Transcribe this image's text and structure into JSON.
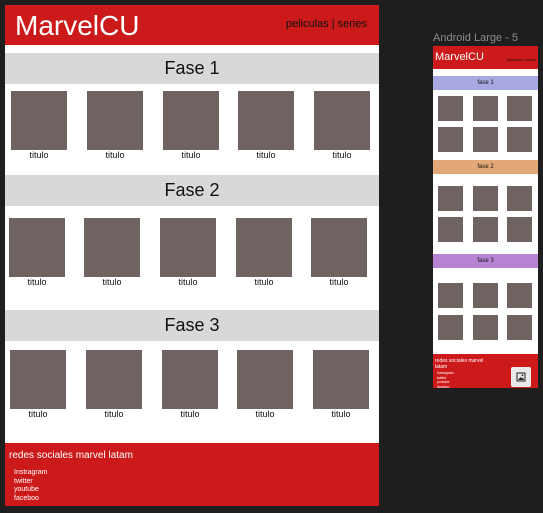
{
  "desktop": {
    "brand": "MarvelCU",
    "nav": "peliculas | series",
    "sections": [
      {
        "title": "Fase 1",
        "items": [
          "titulo",
          "titulo",
          "titulo",
          "titulo",
          "titulo"
        ]
      },
      {
        "title": "Fase 2",
        "items": [
          "titulo",
          "titulo",
          "titulo",
          "titulo",
          "titulo"
        ]
      },
      {
        "title": "Fase 3",
        "items": [
          "titulo",
          "titulo",
          "titulo",
          "titulo",
          "titulo"
        ]
      }
    ],
    "footer": {
      "title": "redes sociales marvel latam",
      "links": [
        "Instragram",
        "twitter",
        "youtube",
        "faceboo"
      ]
    }
  },
  "mobile": {
    "frame_label": "Android Large - 5",
    "brand": "MarvelCU",
    "nav": "peliculas | series",
    "sections": [
      {
        "title": "fase 1",
        "color": "#a8a8e2"
      },
      {
        "title": "fase 2",
        "color": "#e3a878"
      },
      {
        "title": "fase 3",
        "color": "#b983d4"
      }
    ],
    "footer": {
      "title": "redes sociales marvel latam",
      "links": [
        "Instragram",
        "twitter",
        "youtube",
        "faceboo"
      ],
      "image_icon": "image-icon"
    }
  },
  "colors": {
    "header": "#cc1a1a",
    "tile": "#6f6361",
    "band": "#d8d8d8",
    "canvas": "#1e1e1e"
  }
}
